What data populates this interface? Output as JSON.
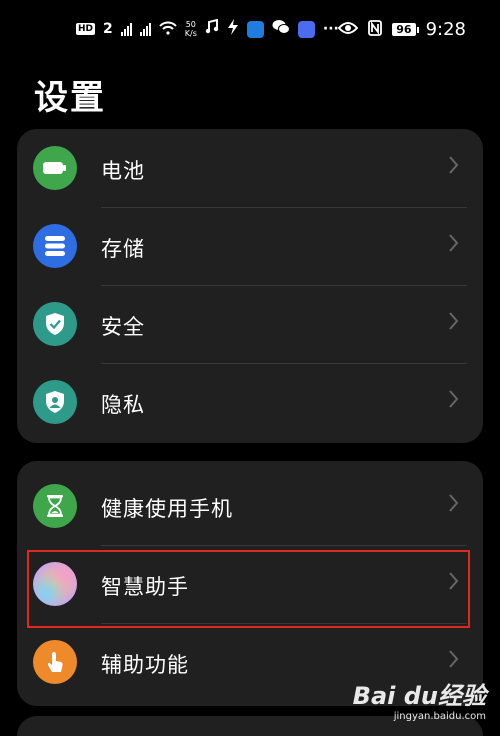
{
  "status_bar": {
    "hd_label": "HD",
    "sim_number": "2",
    "net_speed_value": "50",
    "net_speed_unit": "K/s",
    "more": "···",
    "battery": "96",
    "time": "9:28"
  },
  "page": {
    "title": "设置"
  },
  "groups": [
    {
      "items": [
        {
          "label": "电池",
          "icon": "battery-icon",
          "color": "#3fa64b"
        },
        {
          "label": "存储",
          "icon": "storage-icon",
          "color": "#2f6de3"
        },
        {
          "label": "安全",
          "icon": "shield-icon",
          "color": "#2e9a8a"
        },
        {
          "label": "隐私",
          "icon": "privacy-icon",
          "color": "#2e9a8a"
        }
      ]
    },
    {
      "items": [
        {
          "label": "健康使用手机",
          "icon": "hourglass-icon",
          "color": "#3fa64b"
        },
        {
          "label": "智慧助手",
          "icon": "assistant-orb-icon",
          "color": "#c9a6e8"
        },
        {
          "label": "辅助功能",
          "icon": "hand-icon",
          "color": "#ee8a2a"
        }
      ]
    }
  ],
  "watermark": {
    "logo": "Bai du经验",
    "site": "jingyan.baidu.com"
  }
}
